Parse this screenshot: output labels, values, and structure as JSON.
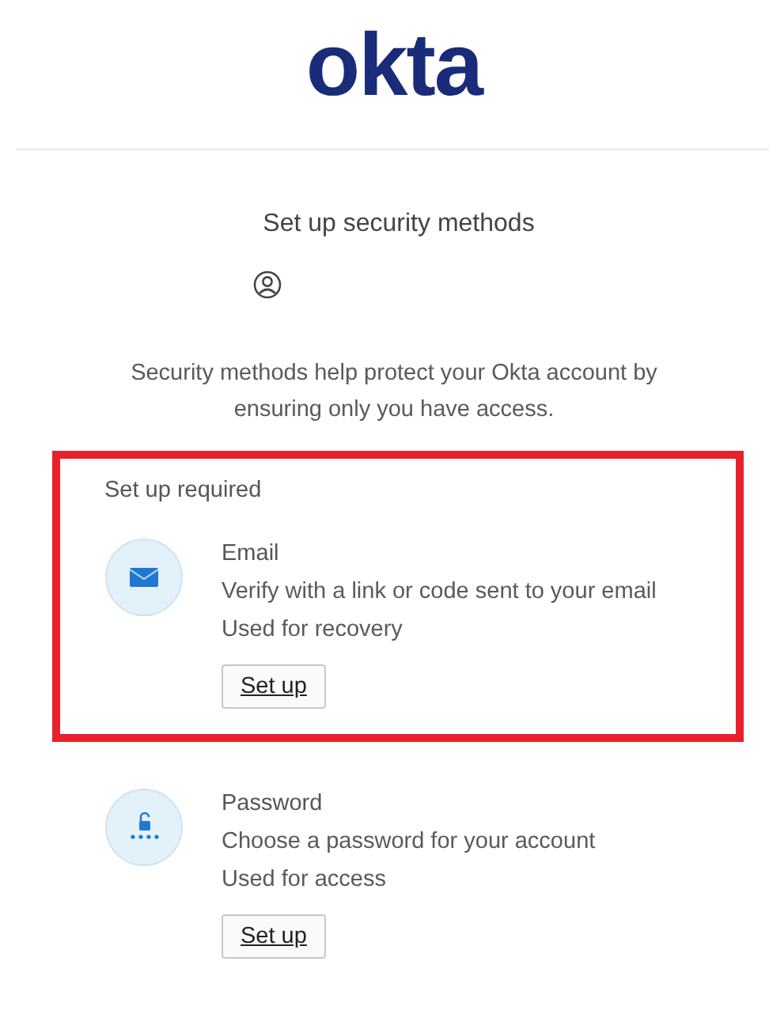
{
  "logo": "okta",
  "title": "Set up security methods",
  "description": "Security methods help protect your Okta account by ensuring only you have access.",
  "sections": [
    {
      "heading": "Set up required",
      "highlighted": true,
      "methods": [
        {
          "kind": "email",
          "name": "Email",
          "description": "Verify with a link or code sent to your email",
          "usage": "Used for recovery",
          "button": "Set up"
        }
      ]
    },
    {
      "highlighted": false,
      "methods": [
        {
          "kind": "password",
          "name": "Password",
          "description": "Choose a password for your account",
          "usage": "Used for access",
          "button": "Set up"
        }
      ]
    }
  ]
}
